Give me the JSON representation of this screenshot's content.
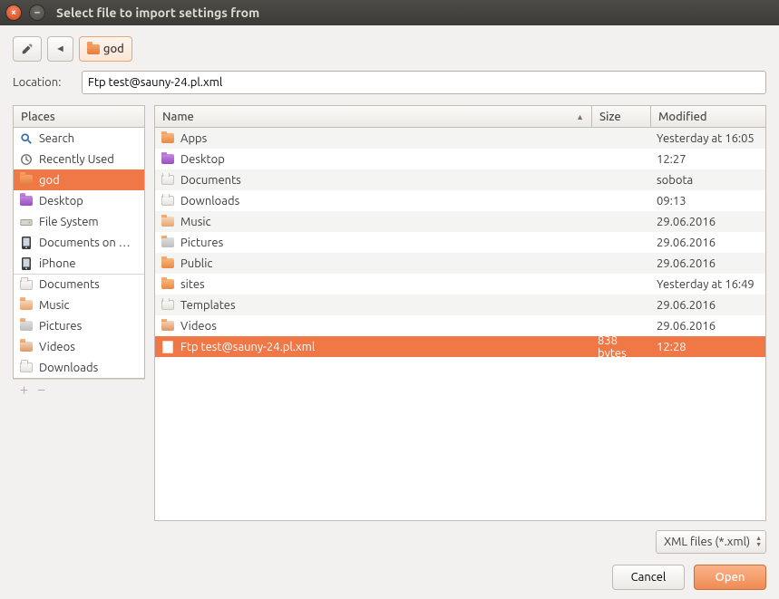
{
  "window": {
    "title": "Select file to import settings from"
  },
  "toolbar": {
    "breadcrumb": "god"
  },
  "location": {
    "label": "Location:",
    "value": "Ftp test@sauny-24.pl.xml"
  },
  "places": {
    "header": "Places",
    "items": [
      {
        "label": "Search",
        "icon": "search",
        "selected": false
      },
      {
        "label": "Recently Used",
        "icon": "recent",
        "selected": false
      },
      {
        "label": "god",
        "icon": "home",
        "selected": true
      },
      {
        "label": "Desktop",
        "icon": "desktop",
        "selected": false
      },
      {
        "label": "File System",
        "icon": "drive",
        "selected": false
      },
      {
        "label": "Documents on …",
        "icon": "phone",
        "selected": false
      },
      {
        "label": "iPhone",
        "icon": "phone",
        "selected": false
      },
      {
        "label": "Documents",
        "icon": "folder-doc",
        "selected": false,
        "sep": true
      },
      {
        "label": "Music",
        "icon": "folder-music",
        "selected": false
      },
      {
        "label": "Pictures",
        "icon": "folder-pic",
        "selected": false
      },
      {
        "label": "Videos",
        "icon": "folder-vid",
        "selected": false
      },
      {
        "label": "Downloads",
        "icon": "folder-dl",
        "selected": false
      }
    ]
  },
  "files": {
    "columns": {
      "name": "Name",
      "size": "Size",
      "modified": "Modified"
    },
    "rows": [
      {
        "name": "Apps",
        "icon": "folder",
        "size": "",
        "modified": "Yesterday at 16:05",
        "selected": false
      },
      {
        "name": "Desktop",
        "icon": "folder-purple",
        "size": "",
        "modified": "12:27",
        "selected": false
      },
      {
        "name": "Documents",
        "icon": "folder-doc",
        "size": "",
        "modified": "sobota",
        "selected": false
      },
      {
        "name": "Downloads",
        "icon": "folder-dl",
        "size": "",
        "modified": "09:13",
        "selected": false
      },
      {
        "name": "Music",
        "icon": "folder-music",
        "size": "",
        "modified": "29.06.2016",
        "selected": false
      },
      {
        "name": "Pictures",
        "icon": "folder-pic",
        "size": "",
        "modified": "29.06.2016",
        "selected": false
      },
      {
        "name": "Public",
        "icon": "folder",
        "size": "",
        "modified": "29.06.2016",
        "selected": false
      },
      {
        "name": "sites",
        "icon": "folder",
        "size": "",
        "modified": "Yesterday at 16:49",
        "selected": false
      },
      {
        "name": "Templates",
        "icon": "folder-white",
        "size": "",
        "modified": "29.06.2016",
        "selected": false
      },
      {
        "name": "Videos",
        "icon": "folder-vid",
        "size": "",
        "modified": "29.06.2016",
        "selected": false
      },
      {
        "name": "Ftp test@sauny-24.pl.xml",
        "icon": "file",
        "size": "838 bytes",
        "modified": "12:28",
        "selected": true
      }
    ]
  },
  "filter": {
    "label": "XML files (*.xml)"
  },
  "actions": {
    "cancel": "Cancel",
    "open": "Open"
  }
}
